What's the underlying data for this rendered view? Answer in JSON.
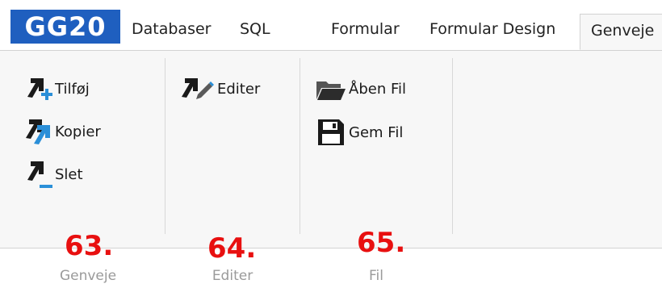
{
  "app": {
    "title": "GG20"
  },
  "tabs": [
    {
      "label": "Databaser"
    },
    {
      "label": "SQL"
    },
    {
      "label": "Formular"
    },
    {
      "label": "Formular Design"
    },
    {
      "label": "Genveje",
      "active": true
    }
  ],
  "groups": {
    "genveje": {
      "label": "Genveje",
      "buttons": {
        "add": "Tilføj",
        "copy": "Kopier",
        "delete": "Slet"
      }
    },
    "editer": {
      "label": "Editer",
      "buttons": {
        "edit": "Editer"
      }
    },
    "fil": {
      "label": "Fil",
      "buttons": {
        "open": "Åben Fil",
        "save": "Gem Fil"
      }
    }
  },
  "annotations": [
    "63.",
    "64.",
    "65."
  ],
  "colors": {
    "brand": "#1f5fbf",
    "annotation": "#e81010",
    "icon_accent": "#2b8fd8"
  }
}
